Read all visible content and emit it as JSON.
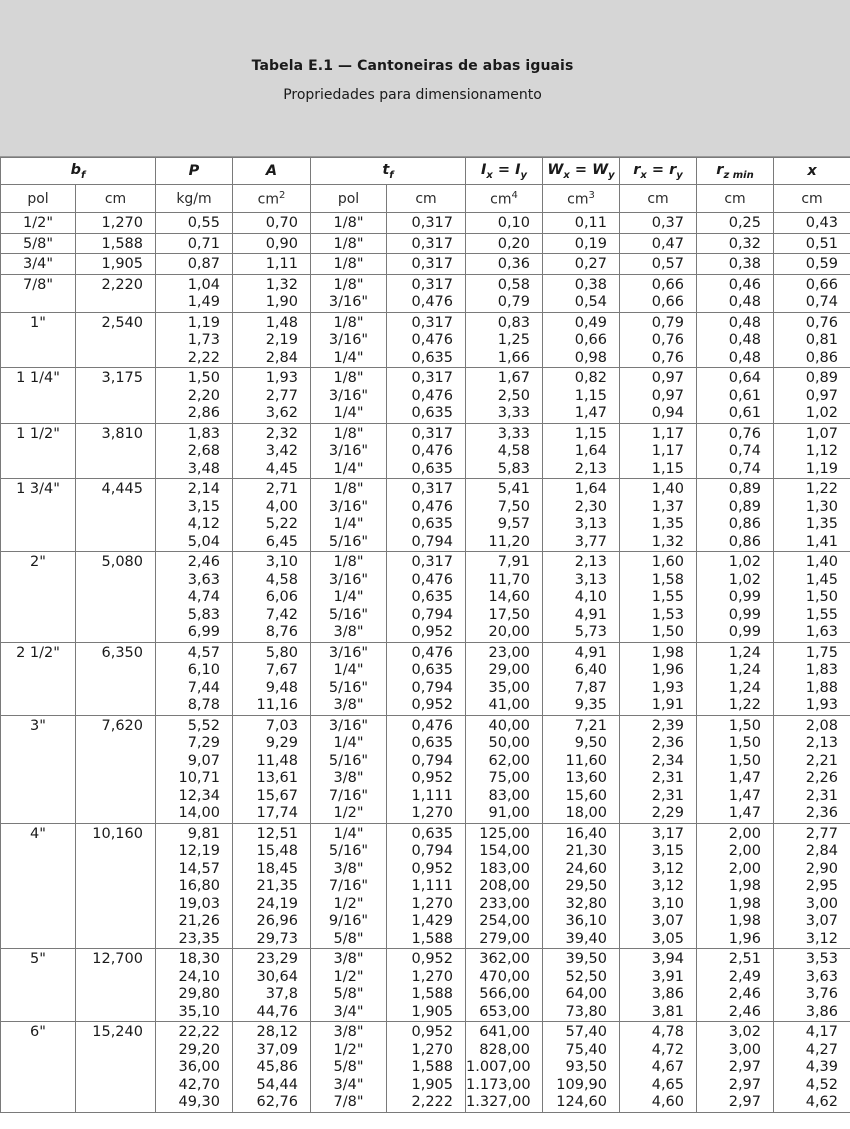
{
  "title": "Tabela E.1 —  Cantoneiras de abas iguais",
  "subtitle": "Propriedades para dimensionamento",
  "units": [
    "pol",
    "cm",
    "kg/m",
    "cm",
    "pol",
    "cm",
    "cm",
    "cm",
    "cm",
    "cm",
    "cm"
  ],
  "unit_powers": {
    "A": "2",
    "I": "4",
    "W": "3"
  },
  "groups": [
    {
      "bf_pol": "1/2\"",
      "bf_cm": "1,270",
      "rows": [
        [
          "0,55",
          "0,70",
          "1/8\"",
          "0,317",
          "0,10",
          "0,11",
          "0,37",
          "0,25",
          "0,43"
        ]
      ]
    },
    {
      "bf_pol": "5/8\"",
      "bf_cm": "1,588",
      "rows": [
        [
          "0,71",
          "0,90",
          "1/8\"",
          "0,317",
          "0,20",
          "0,19",
          "0,47",
          "0,32",
          "0,51"
        ]
      ]
    },
    {
      "bf_pol": "3/4\"",
      "bf_cm": "1,905",
      "rows": [
        [
          "0,87",
          "1,11",
          "1/8\"",
          "0,317",
          "0,36",
          "0,27",
          "0,57",
          "0,38",
          "0,59"
        ]
      ]
    },
    {
      "bf_pol": "7/8\"",
      "bf_cm": "2,220",
      "rows": [
        [
          "1,04",
          "1,32",
          "1/8\"",
          "0,317",
          "0,58",
          "0,38",
          "0,66",
          "0,46",
          "0,66"
        ],
        [
          "1,49",
          "1,90",
          "3/16\"",
          "0,476",
          "0,79",
          "0,54",
          "0,66",
          "0,48",
          "0,74"
        ]
      ]
    },
    {
      "bf_pol": "1\"",
      "bf_cm": "2,540",
      "rows": [
        [
          "1,19",
          "1,48",
          "1/8\"",
          "0,317",
          "0,83",
          "0,49",
          "0,79",
          "0,48",
          "0,76"
        ],
        [
          "1,73",
          "2,19",
          "3/16\"",
          "0,476",
          "1,25",
          "0,66",
          "0,76",
          "0,48",
          "0,81"
        ],
        [
          "2,22",
          "2,84",
          "1/4\"",
          "0,635",
          "1,66",
          "0,98",
          "0,76",
          "0,48",
          "0,86"
        ]
      ]
    },
    {
      "bf_pol": "1 1/4\"",
      "bf_cm": "3,175",
      "rows": [
        [
          "1,50",
          "1,93",
          "1/8\"",
          "0,317",
          "1,67",
          "0,82",
          "0,97",
          "0,64",
          "0,89"
        ],
        [
          "2,20",
          "2,77",
          "3/16\"",
          "0,476",
          "2,50",
          "1,15",
          "0,97",
          "0,61",
          "0,97"
        ],
        [
          "2,86",
          "3,62",
          "1/4\"",
          "0,635",
          "3,33",
          "1,47",
          "0,94",
          "0,61",
          "1,02"
        ]
      ]
    },
    {
      "bf_pol": "1 1/2\"",
      "bf_cm": "3,810",
      "rows": [
        [
          "1,83",
          "2,32",
          "1/8\"",
          "0,317",
          "3,33",
          "1,15",
          "1,17",
          "0,76",
          "1,07"
        ],
        [
          "2,68",
          "3,42",
          "3/16\"",
          "0,476",
          "4,58",
          "1,64",
          "1,17",
          "0,74",
          "1,12"
        ],
        [
          "3,48",
          "4,45",
          "1/4\"",
          "0,635",
          "5,83",
          "2,13",
          "1,15",
          "0,74",
          "1,19"
        ]
      ]
    },
    {
      "bf_pol": "1 3/4\"",
      "bf_cm": "4,445",
      "rows": [
        [
          "2,14",
          "2,71",
          "1/8\"",
          "0,317",
          "5,41",
          "1,64",
          "1,40",
          "0,89",
          "1,22"
        ],
        [
          "3,15",
          "4,00",
          "3/16\"",
          "0,476",
          "7,50",
          "2,30",
          "1,37",
          "0,89",
          "1,30"
        ],
        [
          "4,12",
          "5,22",
          "1/4\"",
          "0,635",
          "9,57",
          "3,13",
          "1,35",
          "0,86",
          "1,35"
        ],
        [
          "5,04",
          "6,45",
          "5/16\"",
          "0,794",
          "11,20",
          "3,77",
          "1,32",
          "0,86",
          "1,41"
        ]
      ]
    },
    {
      "bf_pol": "2\"",
      "bf_cm": "5,080",
      "rows": [
        [
          "2,46",
          "3,10",
          "1/8\"",
          "0,317",
          "7,91",
          "2,13",
          "1,60",
          "1,02",
          "1,40"
        ],
        [
          "3,63",
          "4,58",
          "3/16\"",
          "0,476",
          "11,70",
          "3,13",
          "1,58",
          "1,02",
          "1,45"
        ],
        [
          "4,74",
          "6,06",
          "1/4\"",
          "0,635",
          "14,60",
          "4,10",
          "1,55",
          "0,99",
          "1,50"
        ],
        [
          "5,83",
          "7,42",
          "5/16\"",
          "0,794",
          "17,50",
          "4,91",
          "1,53",
          "0,99",
          "1,55"
        ],
        [
          "6,99",
          "8,76",
          "3/8\"",
          "0,952",
          "20,00",
          "5,73",
          "1,50",
          "0,99",
          "1,63"
        ]
      ]
    },
    {
      "bf_pol": "2 1/2\"",
      "bf_cm": "6,350",
      "rows": [
        [
          "4,57",
          "5,80",
          "3/16\"",
          "0,476",
          "23,00",
          "4,91",
          "1,98",
          "1,24",
          "1,75"
        ],
        [
          "6,10",
          "7,67",
          "1/4\"",
          "0,635",
          "29,00",
          "6,40",
          "1,96",
          "1,24",
          "1,83"
        ],
        [
          "7,44",
          "9,48",
          "5/16\"",
          "0,794",
          "35,00",
          "7,87",
          "1,93",
          "1,24",
          "1,88"
        ],
        [
          "8,78",
          "11,16",
          "3/8\"",
          "0,952",
          "41,00",
          "9,35",
          "1,91",
          "1,22",
          "1,93"
        ]
      ]
    },
    {
      "bf_pol": "3\"",
      "bf_cm": "7,620",
      "rows": [
        [
          "5,52",
          "7,03",
          "3/16\"",
          "0,476",
          "40,00",
          "7,21",
          "2,39",
          "1,50",
          "2,08"
        ],
        [
          "7,29",
          "9,29",
          "1/4\"",
          "0,635",
          "50,00",
          "9,50",
          "2,36",
          "1,50",
          "2,13"
        ],
        [
          "9,07",
          "11,48",
          "5/16\"",
          "0,794",
          "62,00",
          "11,60",
          "2,34",
          "1,50",
          "2,21"
        ],
        [
          "10,71",
          "13,61",
          "3/8\"",
          "0,952",
          "75,00",
          "13,60",
          "2,31",
          "1,47",
          "2,26"
        ],
        [
          "12,34",
          "15,67",
          "7/16\"",
          "1,111",
          "83,00",
          "15,60",
          "2,31",
          "1,47",
          "2,31"
        ],
        [
          "14,00",
          "17,74",
          "1/2\"",
          "1,270",
          "91,00",
          "18,00",
          "2,29",
          "1,47",
          "2,36"
        ]
      ]
    },
    {
      "bf_pol": "4\"",
      "bf_cm": "10,160",
      "rows": [
        [
          "9,81",
          "12,51",
          "1/4\"",
          "0,635",
          "125,00",
          "16,40",
          "3,17",
          "2,00",
          "2,77"
        ],
        [
          "12,19",
          "15,48",
          "5/16\"",
          "0,794",
          "154,00",
          "21,30",
          "3,15",
          "2,00",
          "2,84"
        ],
        [
          "14,57",
          "18,45",
          "3/8\"",
          "0,952",
          "183,00",
          "24,60",
          "3,12",
          "2,00",
          "2,90"
        ],
        [
          "16,80",
          "21,35",
          "7/16\"",
          "1,111",
          "208,00",
          "29,50",
          "3,12",
          "1,98",
          "2,95"
        ],
        [
          "19,03",
          "24,19",
          "1/2\"",
          "1,270",
          "233,00",
          "32,80",
          "3,10",
          "1,98",
          "3,00"
        ],
        [
          "21,26",
          "26,96",
          "9/16\"",
          "1,429",
          "254,00",
          "36,10",
          "3,07",
          "1,98",
          "3,07"
        ],
        [
          "23,35",
          "29,73",
          "5/8\"",
          "1,588",
          "279,00",
          "39,40",
          "3,05",
          "1,96",
          "3,12"
        ]
      ]
    },
    {
      "bf_pol": "5\"",
      "bf_cm": "12,700",
      "rows": [
        [
          "18,30",
          "23,29",
          "3/8\"",
          "0,952",
          "362,00",
          "39,50",
          "3,94",
          "2,51",
          "3,53"
        ],
        [
          "24,10",
          "30,64",
          "1/2\"",
          "1,270",
          "470,00",
          "52,50",
          "3,91",
          "2,49",
          "3,63"
        ],
        [
          "29,80",
          "37,8",
          "5/8\"",
          "1,588",
          "566,00",
          "64,00",
          "3,86",
          "2,46",
          "3,76"
        ],
        [
          "35,10",
          "44,76",
          "3/4\"",
          "1,905",
          "653,00",
          "73,80",
          "3,81",
          "2,46",
          "3,86"
        ]
      ]
    },
    {
      "bf_pol": "6\"",
      "bf_cm": "15,240",
      "rows": [
        [
          "22,22",
          "28,12",
          "3/8\"",
          "0,952",
          "641,00",
          "57,40",
          "4,78",
          "3,02",
          "4,17"
        ],
        [
          "29,20",
          "37,09",
          "1/2\"",
          "1,270",
          "828,00",
          "75,40",
          "4,72",
          "3,00",
          "4,27"
        ],
        [
          "36,00",
          "45,86",
          "5/8\"",
          "1,588",
          "1.007,00",
          "93,50",
          "4,67",
          "2,97",
          "4,39"
        ],
        [
          "42,70",
          "54,44",
          "3/4\"",
          "1,905",
          "1.173,00",
          "109,90",
          "4,65",
          "2,97",
          "4,52"
        ],
        [
          "49,30",
          "62,76",
          "7/8\"",
          "2,222",
          "1.327,00",
          "124,60",
          "4,60",
          "2,97",
          "4,62"
        ]
      ]
    }
  ]
}
